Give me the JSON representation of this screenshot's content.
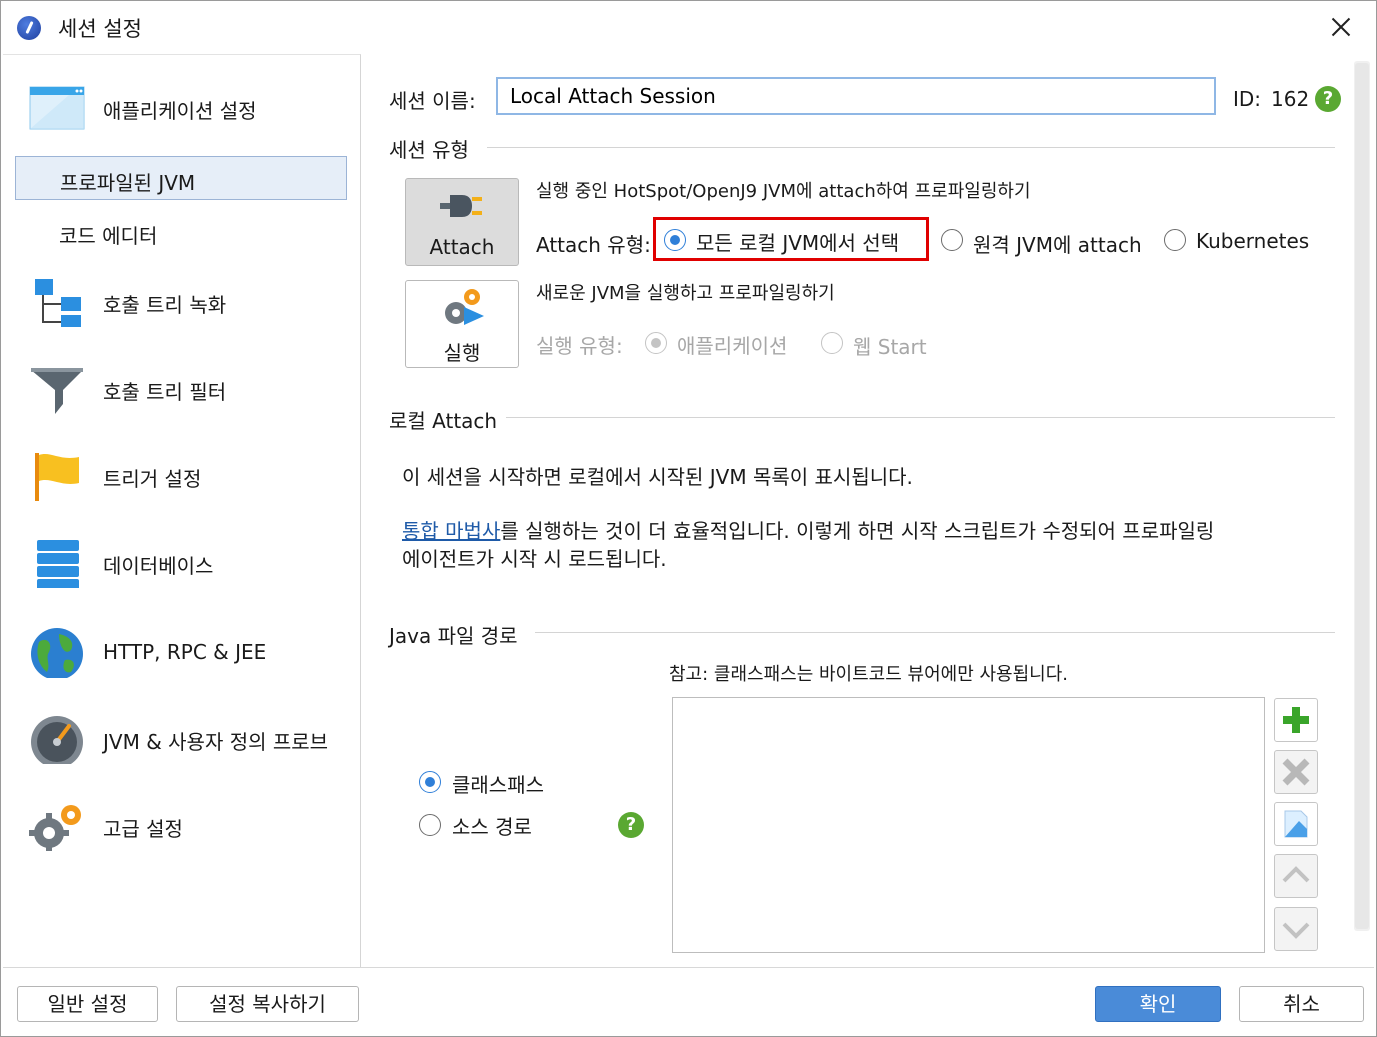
{
  "window": {
    "title": "세션 설정"
  },
  "sidebar": {
    "items": [
      {
        "id": "app-settings",
        "label": "애플리케이션 설정",
        "icon": "window-icon"
      },
      {
        "id": "profiled-jvm",
        "label": "프로파일된 JVM",
        "selected": true
      },
      {
        "id": "code-editor",
        "label": "코드 에디터"
      },
      {
        "id": "call-tree-recording",
        "label": "호출 트리 녹화",
        "icon": "tree-icon"
      },
      {
        "id": "call-tree-filter",
        "label": "호출 트리 필터",
        "icon": "funnel-icon"
      },
      {
        "id": "trigger-settings",
        "label": "트리거 설정",
        "icon": "flag-icon"
      },
      {
        "id": "database",
        "label": "데이터베이스",
        "icon": "database-icon"
      },
      {
        "id": "http-rpc-jee",
        "label": "HTTP, RPC & JEE",
        "icon": "globe-icon"
      },
      {
        "id": "jvm-probes",
        "label": "JVM & 사용자 정의 프로브",
        "icon": "gauge-icon"
      },
      {
        "id": "advanced",
        "label": "고급 설정",
        "icon": "gears-icon"
      }
    ]
  },
  "session": {
    "name_label": "세션 이름:",
    "name_value": "Local Attach Session",
    "id_label": "ID:",
    "id_value": "162"
  },
  "session_type": {
    "heading": "세션 유형",
    "attach": {
      "button_label": "Attach",
      "description": "실행 중인 HotSpot/OpenJ9 JVM에 attach하여 프로파일링하기",
      "type_label": "Attach 유형:",
      "options": [
        "모든 로컬 JVM에서 선택",
        "원격 JVM에 attach",
        "Kubernetes"
      ],
      "selected": 0
    },
    "launch": {
      "button_label": "실행",
      "description": "새로운 JVM을 실행하고 프로파일링하기",
      "type_label": "실행 유형:",
      "options": [
        "애플리케이션",
        "웹 Start"
      ],
      "selected": 0
    }
  },
  "local_attach": {
    "heading": "로컬 Attach",
    "info": "이 세션을 시작하면 로컬에서 시작된 JVM 목록이 표시됩니다.",
    "wizard_link": "통합 마법사",
    "wizard_text_1": "를 실행하는 것이 더 효율적입니다. 이렇게 하면 시작 스크립트가 수정되어 프로파일링",
    "wizard_text_2": "에이전트가 시작 시 로드됩니다."
  },
  "java_paths": {
    "heading": "Java 파일 경로",
    "note": "참고: 클래스패스는 바이트코드 뷰어에만 사용됩니다.",
    "options": [
      "클래스패스",
      "소스 경로"
    ],
    "selected": 0
  },
  "footer": {
    "general_settings": "일반 설정",
    "copy_settings": "설정 복사하기",
    "ok": "확인",
    "cancel": "취소"
  },
  "colors": {
    "accent": "#2f7fd8",
    "primary_button": "#4a8bd8",
    "help": "#5aa832",
    "highlight": "#e00000"
  }
}
